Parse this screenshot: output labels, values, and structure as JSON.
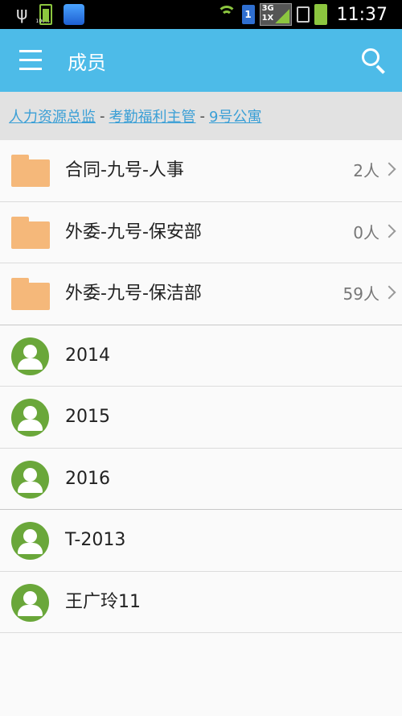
{
  "status_bar": {
    "time": "11:37",
    "battery_small_label": "100%",
    "network_label": "3G\n1X",
    "sim_label": "1"
  },
  "app_bar": {
    "title": "成员"
  },
  "breadcrumb": {
    "items": [
      "人力资源总监",
      "考勤福利主管",
      "9号公寓"
    ],
    "separator": "-"
  },
  "folders": [
    {
      "name": "合同-九号-人事",
      "count": "2人"
    },
    {
      "name": "外委-九号-保安部",
      "count": "0人"
    },
    {
      "name": "外委-九号-保洁部",
      "count": "59人"
    }
  ],
  "members": [
    {
      "name": "2014"
    },
    {
      "name": "2015"
    },
    {
      "name": "2016"
    },
    {
      "name": "T-2013"
    },
    {
      "name": "王广玲11"
    }
  ],
  "colors": {
    "app_bar": "#4dbbe8",
    "folder": "#f5b87a",
    "avatar": "#6aa73a",
    "link": "#3a9fd6"
  }
}
